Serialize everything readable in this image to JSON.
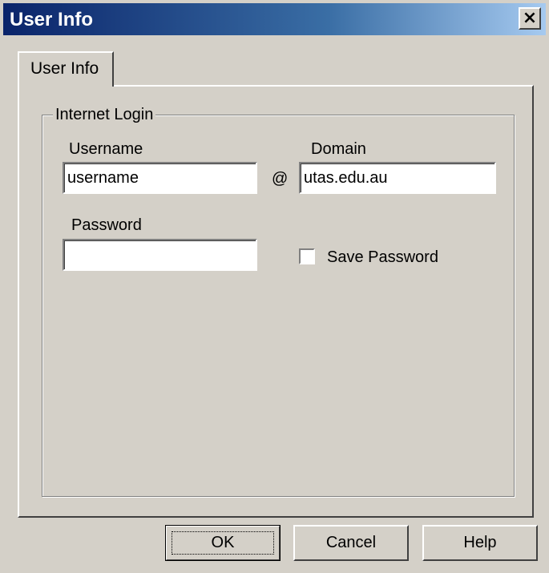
{
  "window": {
    "title": "User Info",
    "close_glyph": "×"
  },
  "tabs": [
    {
      "label": "User Info",
      "selected": true
    }
  ],
  "group": {
    "label": "Internet Login"
  },
  "fields": {
    "username": {
      "label": "Username",
      "value": "username"
    },
    "at_sign": "@",
    "domain": {
      "label": "Domain",
      "value": "utas.edu.au"
    },
    "password": {
      "label": "Password",
      "value": ""
    },
    "save_password": {
      "label": "Save Password",
      "checked": false
    }
  },
  "buttons": {
    "ok": "OK",
    "cancel": "Cancel",
    "help": "Help"
  },
  "colors": {
    "face": "#d4d0c8",
    "title_start": "#0a246a",
    "title_end": "#a6caf0"
  }
}
